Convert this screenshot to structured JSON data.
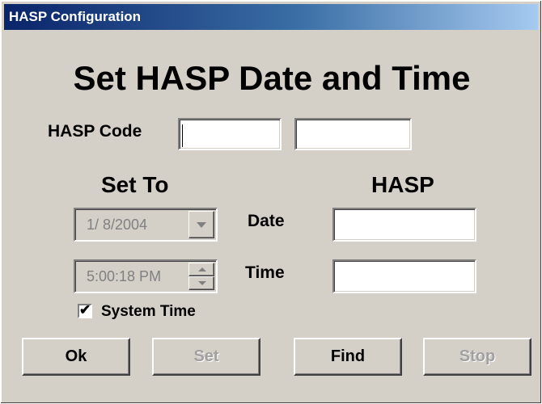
{
  "window": {
    "title": "HASP Configuration"
  },
  "heading": "Set HASP Date and Time",
  "hasp_code": {
    "label": "HASP Code",
    "field1_value": "",
    "field2_value": ""
  },
  "set_to": {
    "header": "Set To",
    "date_value": "1/ 8/2004",
    "time_value": "5:00:18 PM",
    "system_time_label": "System Time",
    "system_time_checked": true,
    "check_glyph": "✔"
  },
  "hasp": {
    "header": "HASP",
    "date_label": "Date",
    "time_label": "Time",
    "date_value": "",
    "time_value": ""
  },
  "buttons": {
    "ok": "Ok",
    "set": "Set",
    "find": "Find",
    "stop": "Stop"
  }
}
